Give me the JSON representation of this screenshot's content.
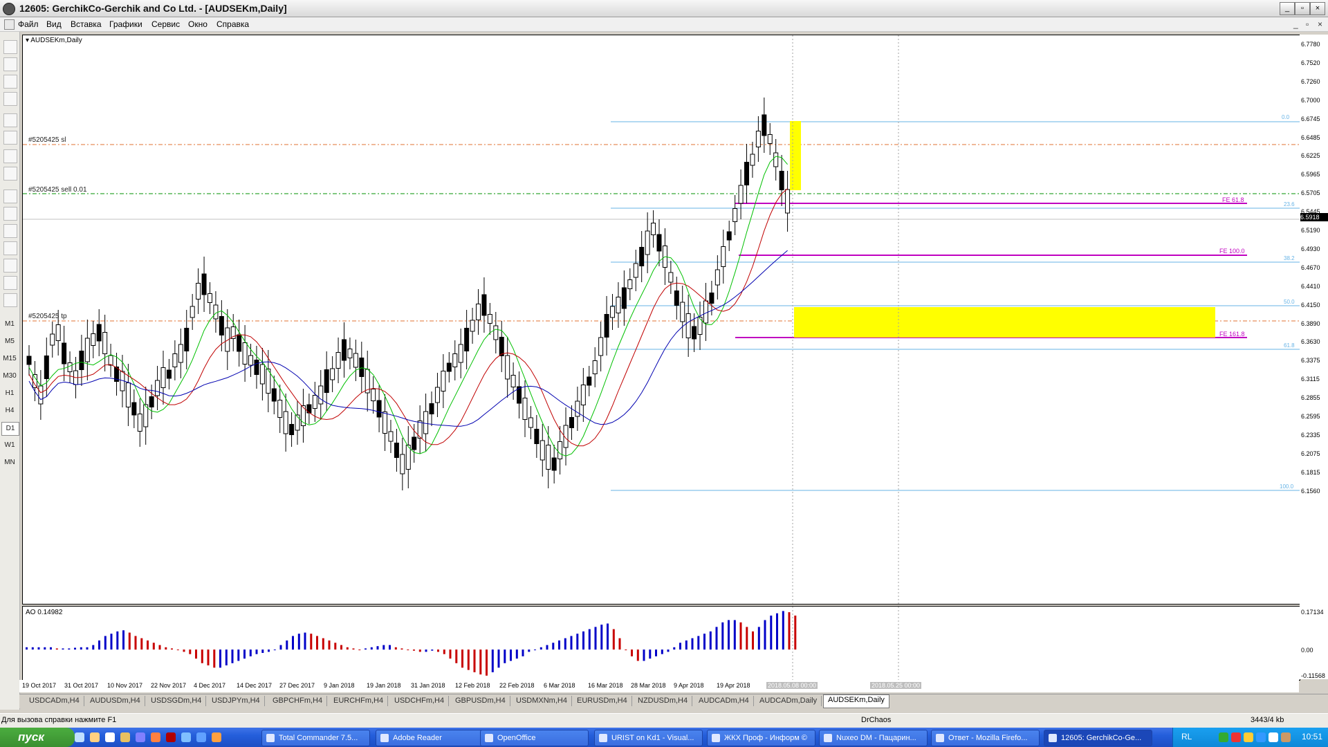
{
  "window": {
    "title": "12605: GerchikCo-Gerchik and Co Ltd. - [AUDSEKm,Daily]",
    "buttons": [
      "_",
      "▫",
      "×"
    ],
    "mdi_buttons": [
      "_",
      "▫",
      "×"
    ]
  },
  "menu": [
    "Файл",
    "Вид",
    "Вставка",
    "Графики",
    "Сервис",
    "Окно",
    "Справка"
  ],
  "timeframes": [
    "M1",
    "M5",
    "M15",
    "M30",
    "H1",
    "H4",
    "D1",
    "W1",
    "MN"
  ],
  "selected_timeframe": "D1",
  "chart": {
    "symbol_label": "AUDSEKm,Daily",
    "order_sl_label": "#5205425 sl",
    "order_sell_label": "#5205425 sell 0.01",
    "order_tp_label": "#5205425 tp",
    "fe_labels": [
      "FE 61.8",
      "FE 100.0",
      "FE 161.8"
    ],
    "fib_labels": [
      "0.0",
      "23.6",
      "38.2",
      "50.0",
      "61.8",
      "100.0"
    ],
    "current_price": "6.5918",
    "price_ticks": [
      "6.7780",
      "6.7520",
      "6.7260",
      "6.7000",
      "6.6745",
      "6.6485",
      "6.6225",
      "6.5965",
      "6.5705",
      "6.5445",
      "6.5190",
      "6.4930",
      "6.4670",
      "6.4410",
      "6.4150",
      "6.3890",
      "6.3630",
      "6.3375",
      "6.3115",
      "6.2855",
      "6.2595",
      "6.2335",
      "6.2075",
      "6.1815",
      "6.1560"
    ],
    "date_ticks": [
      "19 Oct 2017",
      "31 Oct 2017",
      "10 Nov 2017",
      "22 Nov 2017",
      "4 Dec 2017",
      "14 Dec 2017",
      "27 Dec 2017",
      "9 Jan 2018",
      "19 Jan 2018",
      "31 Jan 2018",
      "12 Feb 2018",
      "22 Feb 2018",
      "6 Mar 2018",
      "16 Mar 2018",
      "28 Mar 2018",
      "9 Apr 2018",
      "19 Apr 2018"
    ],
    "date_highlight_1": "2018.05.08 00:00",
    "date_highlight_2": "2018.05.25 00:00",
    "colors": {
      "bull": "#ffffff",
      "bear": "#000000",
      "green": "#00c000",
      "red": "#c00000",
      "blue": "#0000b0",
      "fib": "#66b3e6",
      "fe": "#c000c0",
      "zone": "#ffff00",
      "sl": "#e07030",
      "sell": "#009000"
    }
  },
  "ao": {
    "label": "AO 0.14982",
    "ticks": [
      "0.17134",
      "0.00",
      "-0.11568"
    ],
    "values": [
      0.01,
      0.01,
      0.01,
      0.01,
      0.01,
      0.005,
      0.005,
      0.005,
      0.008,
      0.01,
      0.01,
      0.02,
      0.04,
      0.06,
      0.07,
      0.08,
      0.085,
      0.075,
      0.06,
      0.05,
      0.04,
      0.03,
      0.02,
      0.01,
      0.005,
      0.0,
      -0.01,
      -0.02,
      -0.04,
      -0.06,
      -0.07,
      -0.08,
      -0.08,
      -0.07,
      -0.06,
      -0.05,
      -0.04,
      -0.03,
      -0.02,
      -0.015,
      -0.01,
      0.0,
      0.02,
      0.04,
      0.06,
      0.07,
      0.075,
      0.07,
      0.06,
      0.05,
      0.04,
      0.03,
      0.02,
      0.01,
      0.005,
      0.0,
      0.005,
      0.01,
      0.015,
      0.02,
      0.02,
      0.01,
      0.005,
      0.0,
      -0.005,
      -0.01,
      -0.01,
      -0.005,
      -0.01,
      -0.02,
      -0.04,
      -0.06,
      -0.08,
      -0.09,
      -0.1,
      -0.11,
      -0.115,
      -0.1,
      -0.08,
      -0.06,
      -0.05,
      -0.04,
      -0.03,
      -0.01,
      0.0,
      0.01,
      0.02,
      0.03,
      0.04,
      0.05,
      0.06,
      0.07,
      0.08,
      0.09,
      0.1,
      0.11,
      0.115,
      0.09,
      0.05,
      0.0,
      -0.03,
      -0.05,
      -0.05,
      -0.04,
      -0.03,
      -0.02,
      -0.01,
      0.01,
      0.03,
      0.04,
      0.05,
      0.06,
      0.07,
      0.08,
      0.1,
      0.12,
      0.13,
      0.13,
      0.12,
      0.1,
      0.08,
      0.1,
      0.13,
      0.15,
      0.16,
      0.17,
      0.165,
      0.15
    ],
    "colors": [
      "#0000c8",
      "#c80000"
    ]
  },
  "symbol_tabs": [
    "USDCADm,H4",
    "AUDUSDm,H4",
    "USDSGDm,H4",
    "USDJPYm,H4",
    "GBPCHFm,H4",
    "EURCHFm,H4",
    "USDCHFm,H4",
    "GBPUSDm,H4",
    "USDMXNm,H4",
    "EURUSDm,H4",
    "NZDUSDm,H4",
    "AUDCADm,H4",
    "AUDCADm,Daily",
    "AUDSEKm,Daily"
  ],
  "status": {
    "help": "Для вызова справки нажмите F1",
    "profile": "DrChaos",
    "traffic": "3443/4 kb"
  },
  "taskbar": {
    "start": "пуск",
    "tasks": [
      "Total Commander 7.5...",
      "Adobe Reader",
      "OpenOffice",
      "URIST on Kd1 - Visual...",
      "ЖКХ Проф - Информ ©",
      "Nuxeo DM - Пацарин...",
      "Ответ - Mozilla Firefo...",
      "12605: GerchikCo-Ge..."
    ],
    "lang": "RL",
    "clock": "10:51"
  }
}
